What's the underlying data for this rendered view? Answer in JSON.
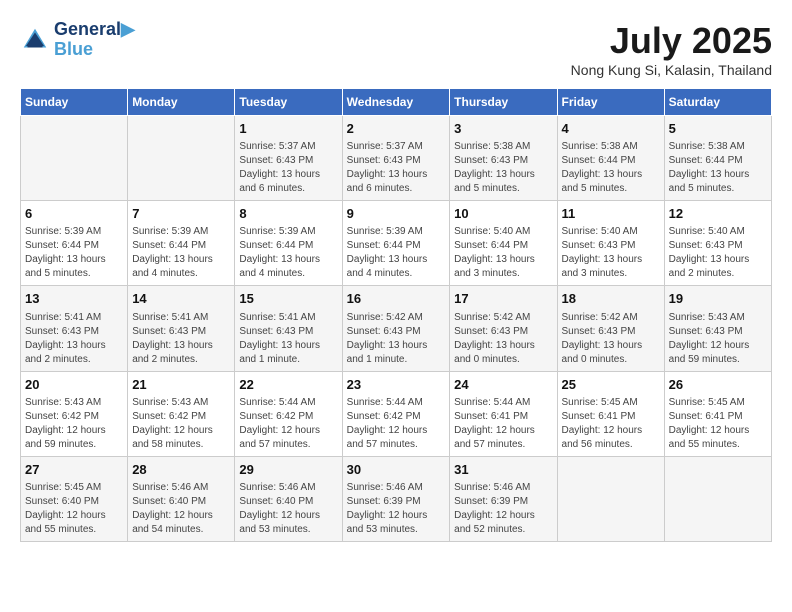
{
  "header": {
    "logo_line1": "General",
    "logo_line2": "Blue",
    "month_title": "July 2025",
    "subtitle": "Nong Kung Si, Kalasin, Thailand"
  },
  "weekdays": [
    "Sunday",
    "Monday",
    "Tuesday",
    "Wednesday",
    "Thursday",
    "Friday",
    "Saturday"
  ],
  "weeks": [
    [
      {
        "day": "",
        "info": ""
      },
      {
        "day": "",
        "info": ""
      },
      {
        "day": "1",
        "info": "Sunrise: 5:37 AM\nSunset: 6:43 PM\nDaylight: 13 hours and 6 minutes."
      },
      {
        "day": "2",
        "info": "Sunrise: 5:37 AM\nSunset: 6:43 PM\nDaylight: 13 hours and 6 minutes."
      },
      {
        "day": "3",
        "info": "Sunrise: 5:38 AM\nSunset: 6:43 PM\nDaylight: 13 hours and 5 minutes."
      },
      {
        "day": "4",
        "info": "Sunrise: 5:38 AM\nSunset: 6:44 PM\nDaylight: 13 hours and 5 minutes."
      },
      {
        "day": "5",
        "info": "Sunrise: 5:38 AM\nSunset: 6:44 PM\nDaylight: 13 hours and 5 minutes."
      }
    ],
    [
      {
        "day": "6",
        "info": "Sunrise: 5:39 AM\nSunset: 6:44 PM\nDaylight: 13 hours and 5 minutes."
      },
      {
        "day": "7",
        "info": "Sunrise: 5:39 AM\nSunset: 6:44 PM\nDaylight: 13 hours and 4 minutes."
      },
      {
        "day": "8",
        "info": "Sunrise: 5:39 AM\nSunset: 6:44 PM\nDaylight: 13 hours and 4 minutes."
      },
      {
        "day": "9",
        "info": "Sunrise: 5:39 AM\nSunset: 6:44 PM\nDaylight: 13 hours and 4 minutes."
      },
      {
        "day": "10",
        "info": "Sunrise: 5:40 AM\nSunset: 6:44 PM\nDaylight: 13 hours and 3 minutes."
      },
      {
        "day": "11",
        "info": "Sunrise: 5:40 AM\nSunset: 6:43 PM\nDaylight: 13 hours and 3 minutes."
      },
      {
        "day": "12",
        "info": "Sunrise: 5:40 AM\nSunset: 6:43 PM\nDaylight: 13 hours and 2 minutes."
      }
    ],
    [
      {
        "day": "13",
        "info": "Sunrise: 5:41 AM\nSunset: 6:43 PM\nDaylight: 13 hours and 2 minutes."
      },
      {
        "day": "14",
        "info": "Sunrise: 5:41 AM\nSunset: 6:43 PM\nDaylight: 13 hours and 2 minutes."
      },
      {
        "day": "15",
        "info": "Sunrise: 5:41 AM\nSunset: 6:43 PM\nDaylight: 13 hours and 1 minute."
      },
      {
        "day": "16",
        "info": "Sunrise: 5:42 AM\nSunset: 6:43 PM\nDaylight: 13 hours and 1 minute."
      },
      {
        "day": "17",
        "info": "Sunrise: 5:42 AM\nSunset: 6:43 PM\nDaylight: 13 hours and 0 minutes."
      },
      {
        "day": "18",
        "info": "Sunrise: 5:42 AM\nSunset: 6:43 PM\nDaylight: 13 hours and 0 minutes."
      },
      {
        "day": "19",
        "info": "Sunrise: 5:43 AM\nSunset: 6:43 PM\nDaylight: 12 hours and 59 minutes."
      }
    ],
    [
      {
        "day": "20",
        "info": "Sunrise: 5:43 AM\nSunset: 6:42 PM\nDaylight: 12 hours and 59 minutes."
      },
      {
        "day": "21",
        "info": "Sunrise: 5:43 AM\nSunset: 6:42 PM\nDaylight: 12 hours and 58 minutes."
      },
      {
        "day": "22",
        "info": "Sunrise: 5:44 AM\nSunset: 6:42 PM\nDaylight: 12 hours and 57 minutes."
      },
      {
        "day": "23",
        "info": "Sunrise: 5:44 AM\nSunset: 6:42 PM\nDaylight: 12 hours and 57 minutes."
      },
      {
        "day": "24",
        "info": "Sunrise: 5:44 AM\nSunset: 6:41 PM\nDaylight: 12 hours and 57 minutes."
      },
      {
        "day": "25",
        "info": "Sunrise: 5:45 AM\nSunset: 6:41 PM\nDaylight: 12 hours and 56 minutes."
      },
      {
        "day": "26",
        "info": "Sunrise: 5:45 AM\nSunset: 6:41 PM\nDaylight: 12 hours and 55 minutes."
      }
    ],
    [
      {
        "day": "27",
        "info": "Sunrise: 5:45 AM\nSunset: 6:40 PM\nDaylight: 12 hours and 55 minutes."
      },
      {
        "day": "28",
        "info": "Sunrise: 5:46 AM\nSunset: 6:40 PM\nDaylight: 12 hours and 54 minutes."
      },
      {
        "day": "29",
        "info": "Sunrise: 5:46 AM\nSunset: 6:40 PM\nDaylight: 12 hours and 53 minutes."
      },
      {
        "day": "30",
        "info": "Sunrise: 5:46 AM\nSunset: 6:39 PM\nDaylight: 12 hours and 53 minutes."
      },
      {
        "day": "31",
        "info": "Sunrise: 5:46 AM\nSunset: 6:39 PM\nDaylight: 12 hours and 52 minutes."
      },
      {
        "day": "",
        "info": ""
      },
      {
        "day": "",
        "info": ""
      }
    ]
  ]
}
